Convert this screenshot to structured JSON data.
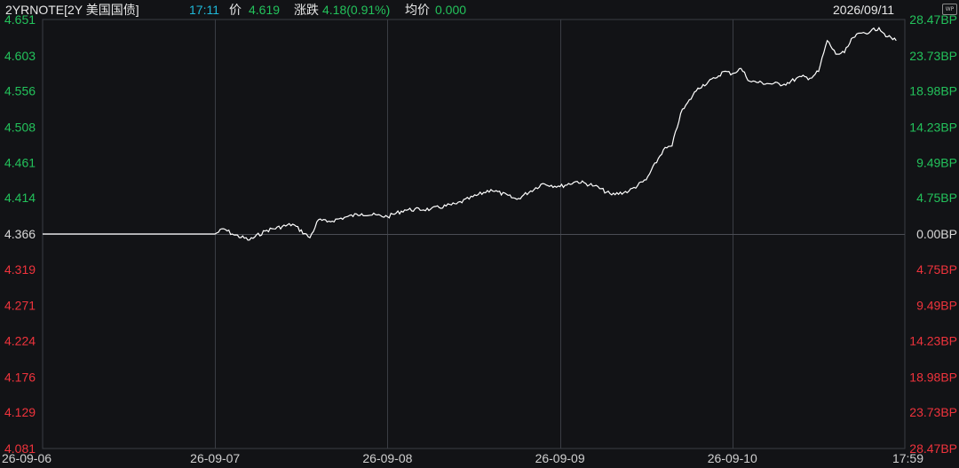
{
  "header": {
    "symbol": "2YRNOTE[2Y 美国国债]",
    "time": "17:11",
    "price_label": "价",
    "price": "4.619",
    "change_label": "涨跌",
    "change": "4.18(0.91%)",
    "avg_label": "均价",
    "avg": "0.000",
    "date": "2026/09/11",
    "wp_icon_text": "WP"
  },
  "chart_data": {
    "type": "line",
    "y_left_ticks": [
      "4.651",
      "4.603",
      "4.556",
      "4.508",
      "4.461",
      "4.414",
      "4.366",
      "4.319",
      "4.271",
      "4.224",
      "4.176",
      "4.129",
      "4.081"
    ],
    "y_right_ticks": [
      "28.47BP",
      "23.73BP",
      "18.98BP",
      "14.23BP",
      "9.49BP",
      "4.75BP",
      "0.00BP",
      "4.75BP",
      "9.49BP",
      "14.23BP",
      "18.98BP",
      "23.73BP",
      "28.47BP"
    ],
    "x_ticks": [
      "26-09-06",
      "26-09-07",
      "26-09-08",
      "26-09-09",
      "26-09-10",
      "17:59"
    ],
    "ylim": [
      4.081,
      4.651
    ],
    "baseline": 4.366,
    "series": [
      {
        "x": [
          0,
          1.0,
          1.05,
          1.1,
          1.2,
          1.3,
          1.45,
          1.55,
          1.6,
          1.65,
          1.75,
          1.85,
          2.0,
          2.1,
          2.25,
          2.4,
          2.6,
          2.75,
          2.9,
          3.0,
          3.1,
          3.2,
          3.3,
          3.4,
          3.5,
          3.6,
          3.65,
          3.7,
          3.8,
          3.9,
          3.95,
          4.0,
          4.05,
          4.1,
          4.2,
          4.3,
          4.4,
          4.45,
          4.5,
          4.55,
          4.6,
          4.65,
          4.7,
          4.75,
          4.8,
          4.85,
          4.9,
          4.95
        ],
        "values": [
          4.366,
          4.366,
          4.373,
          4.366,
          4.358,
          4.371,
          4.379,
          4.361,
          4.385,
          4.382,
          4.388,
          4.393,
          4.389,
          4.398,
          4.399,
          4.406,
          4.425,
          4.412,
          4.433,
          4.429,
          4.436,
          4.43,
          4.418,
          4.423,
          4.438,
          4.478,
          4.483,
          4.526,
          4.56,
          4.573,
          4.582,
          4.579,
          4.586,
          4.569,
          4.566,
          4.565,
          4.575,
          4.573,
          4.582,
          4.623,
          4.605,
          4.607,
          4.627,
          4.633,
          4.635,
          4.64,
          4.628,
          4.623
        ]
      }
    ],
    "colors": {
      "up": "#23c25b",
      "down": "#f0333c",
      "line": "#ffffff",
      "grid": "#3a3d44",
      "base": "#d8d8d8"
    }
  }
}
